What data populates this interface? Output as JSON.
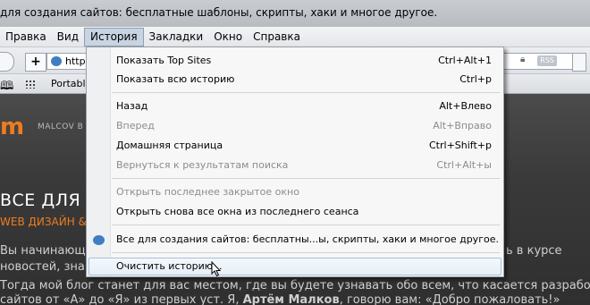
{
  "window": {
    "title": "для создания сайтов: бесплатные шаблоны, скрипты, хаки и многое другое."
  },
  "menubar": {
    "items": [
      "Правка",
      "Вид",
      "История",
      "Закладки",
      "Окно",
      "Справка"
    ],
    "active": "История"
  },
  "navbar": {
    "url_text": "http",
    "rss_label": "RSS"
  },
  "bookmarks": {
    "item_label": "Portabl"
  },
  "page": {
    "brand": "MALCOV B",
    "hero": "ВСЕ ДЛЯ Н",
    "subhero": "WEB ДИЗАЙН & F",
    "line1": "Вы начинающ",
    "line1_right": "ь в курсе",
    "line2": "новостей, знак",
    "line3": "Тогда мой блог станет для вас местом, где вы будете узнавать обо всем, что касается разработки",
    "line4_a": "сайтов от «А» до «Я» из первых уст. Я, ",
    "line4_b": "Артём Малков",
    "line4_c": ", говорю вам: «Добро пожаловать!»"
  },
  "history_menu": {
    "items": [
      {
        "label": "Показать Top Sites",
        "shortcut": "Ctrl+Alt+1",
        "enabled": true
      },
      {
        "label": "Показать всю историю",
        "shortcut": "Ctrl+p",
        "enabled": true
      },
      {
        "label": "Назад",
        "shortcut": "Alt+Влево",
        "enabled": true
      },
      {
        "label": "Вперед",
        "shortcut": "Alt+Вправо",
        "enabled": false
      },
      {
        "label": "Домашняя страница",
        "shortcut": "Ctrl+Shift+p",
        "enabled": true
      },
      {
        "label": "Вернуться к результатам поиска",
        "shortcut": "Ctrl+Alt+ы",
        "enabled": false
      },
      {
        "label": "Открыть последнее закрытое окно",
        "shortcut": "",
        "enabled": false
      },
      {
        "label": "Открыть снова все окна из последнего сеанса",
        "shortcut": "",
        "enabled": true
      },
      {
        "label": "Все для создания сайтов: бесплатны...ы, скрипты, хаки и многое другое.",
        "shortcut": "",
        "enabled": true
      },
      {
        "label": "Очистить историю...",
        "shortcut": "",
        "enabled": true
      }
    ]
  },
  "colors": {
    "accent": "#f07c1e",
    "menu_highlight": "#a9c0da"
  }
}
